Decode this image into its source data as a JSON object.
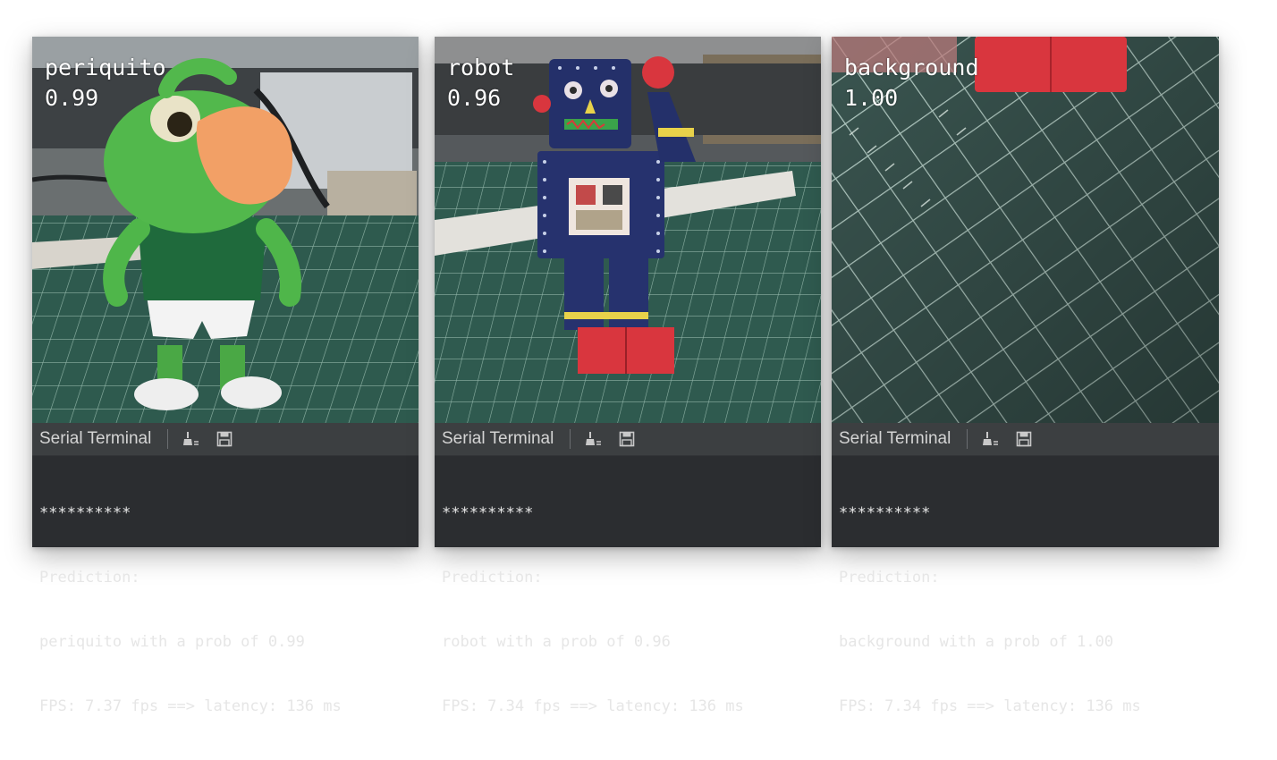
{
  "panels": [
    {
      "overlay": {
        "label": "periquito",
        "score": "0.99"
      },
      "terminal": {
        "title": "Serial Terminal",
        "lines": [
          "**********",
          "Prediction:",
          "periquito with a prob of 0.99",
          "FPS: 7.37 fps ==> latency: 136 ms"
        ]
      }
    },
    {
      "overlay": {
        "label": "robot",
        "score": "0.96"
      },
      "terminal": {
        "title": "Serial Terminal",
        "lines": [
          "**********",
          "Prediction:",
          "robot with a prob of 0.96",
          "FPS: 7.34 fps ==> latency: 136 ms"
        ]
      }
    },
    {
      "overlay": {
        "label": "background",
        "score": "1.00"
      },
      "terminal": {
        "title": "Serial Terminal",
        "lines": [
          "**********",
          "Prediction:",
          "background with a prob of 1.00",
          "FPS: 7.34 fps ==> latency: 136 ms"
        ]
      }
    }
  ],
  "icons": {
    "clear": "broom-icon",
    "save": "save-icon"
  },
  "colors": {
    "terminal_bg": "#2b2d30",
    "terminal_header": "#3c3f41",
    "mat_green": "#2f5a4f",
    "grid_line": "#a9c7bd",
    "figure_green": "#4fb64a",
    "beak_orange": "#f2a066",
    "robot_blue": "#24306a",
    "robot_red": "#d9363e"
  }
}
